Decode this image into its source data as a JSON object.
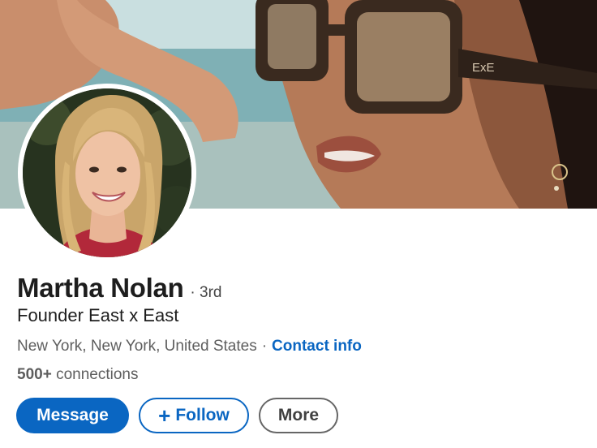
{
  "profile": {
    "name": "Martha Nolan",
    "degree": "· 3rd",
    "headline": "Founder East x East",
    "location": "New York, New York, United States",
    "separator": "·",
    "contact_label": "Contact info",
    "connections_count": "500+",
    "connections_label": "connections"
  },
  "actions": {
    "message_label": "Message",
    "follow_icon": "+",
    "follow_label": "Follow",
    "more_label": "More"
  },
  "banner": {
    "frame_logo": "ExE"
  },
  "colors": {
    "accent": "#0a66c2",
    "text_primary": "#1d1d1d",
    "text_secondary": "#5e5e5e"
  }
}
